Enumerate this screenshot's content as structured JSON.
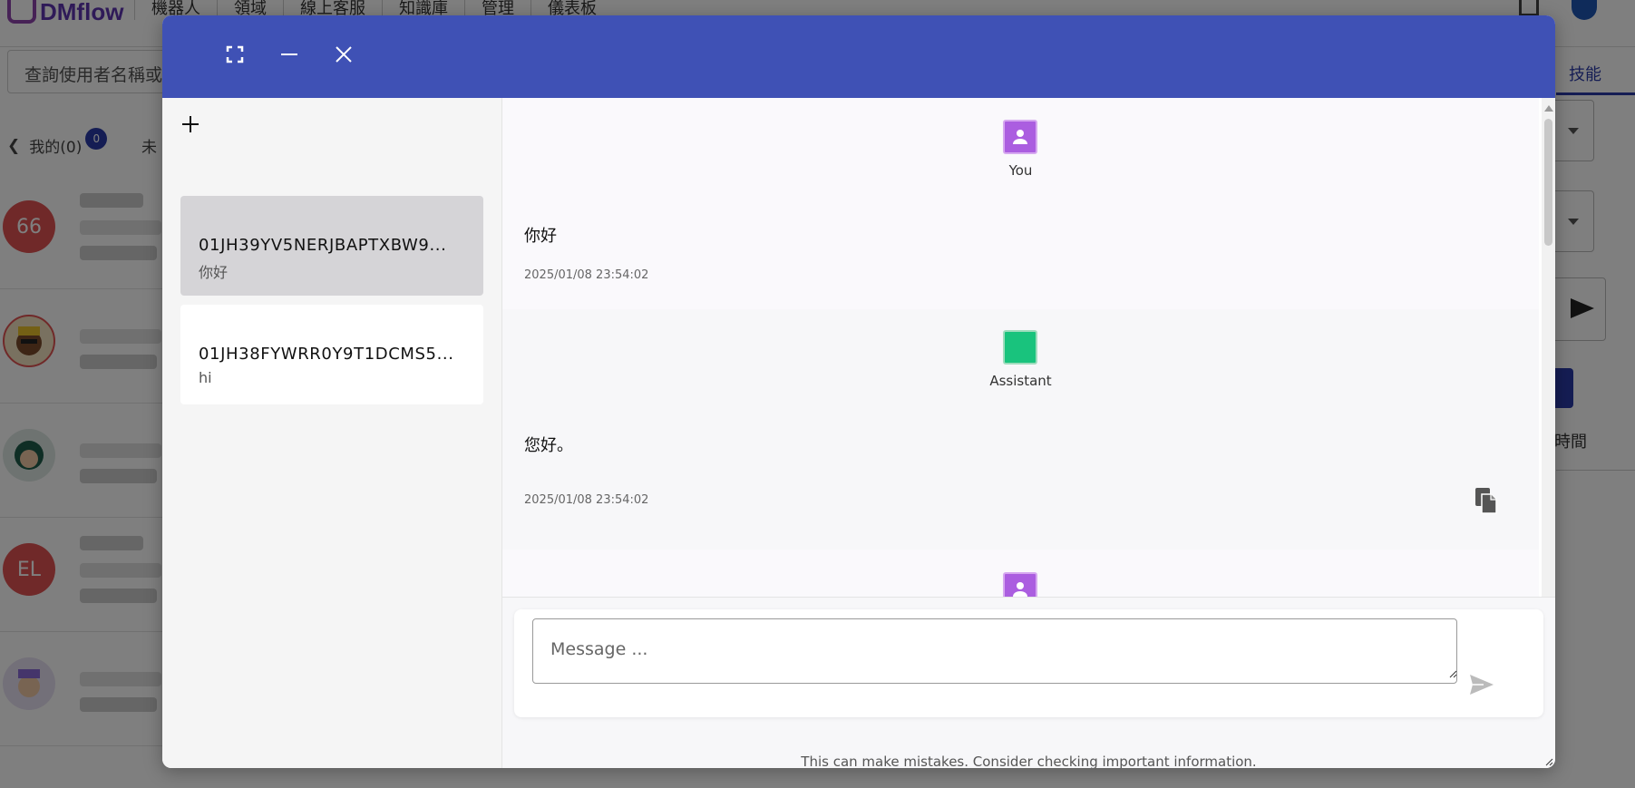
{
  "background": {
    "logo_text": "DMflow",
    "menu": [
      "機器人",
      "領域",
      "線上客服",
      "知識庫",
      "管理",
      "儀表板"
    ],
    "search_placeholder": "查詢使用者名稱或",
    "tab_mine": "我的(0)",
    "tab_mine_badge": "0",
    "tab_unassigned": "未",
    "avatars": [
      {
        "initials": "66",
        "color": "#e05252"
      },
      {
        "initials": "",
        "color": "#f0f0f0"
      },
      {
        "initials": "",
        "color": "#f0f0f0"
      },
      {
        "initials": "EL",
        "color": "#e05252"
      },
      {
        "initials": "",
        "color": "#f0f0f0"
      }
    ],
    "right_tab": "技能",
    "right_time_label": "時間"
  },
  "dialog": {
    "header_color": "#3f51b5",
    "icons": [
      "fullscreen-icon",
      "minimize-icon",
      "close-icon"
    ],
    "conversations": [
      {
        "title": "01JH39YV5NERJBAPTXBW9...",
        "preview": "你好",
        "active": true
      },
      {
        "title": "01JH38FYWRR0Y9T1DCMS5...",
        "preview": "hi",
        "active": false
      }
    ],
    "messages": [
      {
        "role": "You",
        "text": "你好",
        "time": "2025/01/08 23:54:02",
        "avatar_color": "#ab5ee0"
      },
      {
        "role": "Assistant",
        "text": "您好。",
        "time": "2025/01/08 23:54:02",
        "avatar_color": "#19c37d"
      }
    ],
    "input_placeholder": "Message ...",
    "disclaimer": "This can make mistakes. Consider checking important information."
  }
}
